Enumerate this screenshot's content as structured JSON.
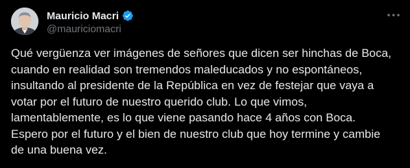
{
  "author": {
    "display_name": "Mauricio Macri",
    "handle": "@mauriciomacri",
    "verified": true,
    "verified_color": "#1d9bf0"
  },
  "icons": {
    "avatar": "profile-photo",
    "verified": "verified-badge-icon",
    "more": "more-options-icon"
  },
  "tweet": {
    "lines": [
      "Qué vergüenza ver imágenes de señores que dicen ser hinchas de Boca,",
      "cuando en realidad son tremendos maleducados y no espontáneos,",
      "insultando al presidente de la República en vez de festejar que vaya a",
      "votar por el futuro de nuestro querido club. Lo que vimos,",
      "lamentablemente, es lo que viene pasando hace 4 años con Boca.",
      "Espero por el futuro y el bien de nuestro club que hoy termine y cambie",
      "de una buena vez."
    ]
  },
  "colors": {
    "background": "#000000",
    "text": "#e7e9ea",
    "secondary": "#71767b"
  }
}
